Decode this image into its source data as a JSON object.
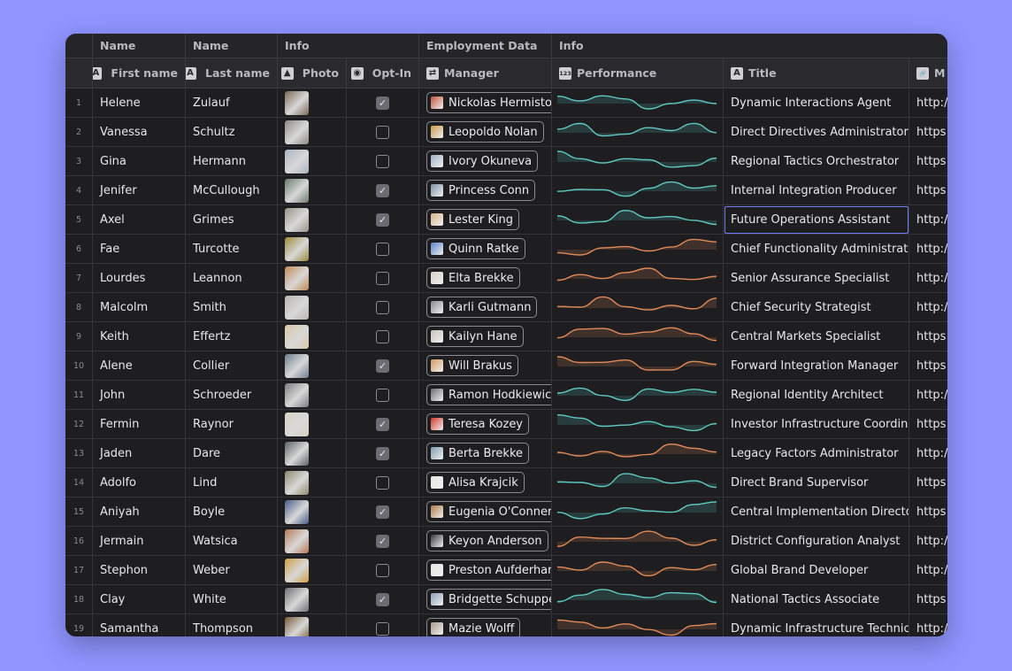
{
  "group_headers": [
    {
      "label": "",
      "col": 0
    },
    {
      "label": "Name",
      "col": 1
    },
    {
      "label": "Name",
      "col": 2
    },
    {
      "label": "Info",
      "col": 3
    },
    {
      "label": "Employment Data",
      "col": 5
    },
    {
      "label": "Info",
      "col": 6
    }
  ],
  "columns": [
    {
      "label": "",
      "icon": "",
      "icon_name": ""
    },
    {
      "label": "First name",
      "icon": "A",
      "icon_name": "text-icon"
    },
    {
      "label": "Last name",
      "icon": "A",
      "icon_name": "text-icon"
    },
    {
      "label": "Photo",
      "icon": "▲",
      "icon_name": "image-icon"
    },
    {
      "label": "Opt-In",
      "icon": "◉",
      "icon_name": "toggle-icon"
    },
    {
      "label": "Manager",
      "icon": "⇄",
      "icon_name": "relation-icon"
    },
    {
      "label": "Performance",
      "icon": "123",
      "icon_name": "number-icon"
    },
    {
      "label": "Title",
      "icon": "A",
      "icon_name": "text-icon"
    },
    {
      "label": "M",
      "icon": "🔗",
      "icon_name": "link-icon"
    }
  ],
  "colors": {
    "background": "#8f94ff",
    "window": "#1e1e20",
    "selection": "#6f7cff",
    "spark_teal": "#5fc9c0",
    "spark_orange": "#e08a5a"
  },
  "rows": [
    {
      "n": "1",
      "first": "Helene",
      "last": "Zulauf",
      "photo": "#7a6a55",
      "opt": true,
      "manager": "Nickolas Hermiston",
      "mgr_color": "#c0533a",
      "title": "Dynamic Interactions Agent",
      "url": "http://",
      "trend": "teal"
    },
    {
      "n": "2",
      "first": "Vanessa",
      "last": "Schultz",
      "photo": "#8c8a86",
      "opt": false,
      "manager": "Leopoldo Nolan",
      "mgr_color": "#c99a4a",
      "title": "Direct Directives Administrator",
      "url": "https:",
      "trend": "teal"
    },
    {
      "n": "3",
      "first": "Gina",
      "last": "Hermann",
      "photo": "#a9b4bf",
      "opt": false,
      "manager": "Ivory Okuneva",
      "mgr_color": "#9fb0c4",
      "title": "Regional Tactics Orchestrator",
      "url": "https:",
      "trend": "teal"
    },
    {
      "n": "4",
      "first": "Jenifer",
      "last": "McCullough",
      "photo": "#6a7a6e",
      "opt": true,
      "manager": "Princess Conn",
      "mgr_color": "#7d93a6",
      "title": "Internal Integration Producer",
      "url": "https:",
      "trend": "teal"
    },
    {
      "n": "5",
      "first": "Axel",
      "last": "Grimes",
      "photo": "#9a9288",
      "opt": true,
      "manager": "Lester King",
      "mgr_color": "#d6b48a",
      "title": "Future Operations Assistant",
      "url": "http://",
      "trend": "teal"
    },
    {
      "n": "6",
      "first": "Fae",
      "last": "Turcotte",
      "photo": "#9a8a3a",
      "opt": false,
      "manager": "Quinn Ratke",
      "mgr_color": "#5a84c9",
      "title": "Chief Functionality Administrator",
      "url": "http://",
      "trend": "orange"
    },
    {
      "n": "7",
      "first": "Lourdes",
      "last": "Leannon",
      "photo": "#c08a55",
      "opt": false,
      "manager": "Elta Brekke",
      "mgr_color": "#d8d2c8",
      "title": "Senior Assurance Specialist",
      "url": "http://",
      "trend": "orange"
    },
    {
      "n": "8",
      "first": "Malcolm",
      "last": "Smith",
      "photo": "#b8b6b2",
      "opt": false,
      "manager": "Karli Gutmann",
      "mgr_color": "#8a8a8e",
      "title": "Chief Security Strategist",
      "url": "http://",
      "trend": "orange"
    },
    {
      "n": "9",
      "first": "Keith",
      "last": "Effertz",
      "photo": "#d9c6a6",
      "opt": false,
      "manager": "Kailyn Hane",
      "mgr_color": "#c9c3ba",
      "title": "Central Markets Specialist",
      "url": "https:",
      "trend": "orange"
    },
    {
      "n": "10",
      "first": "Alene",
      "last": "Collier",
      "photo": "#6f7e8c",
      "opt": true,
      "manager": "Will Brakus",
      "mgr_color": "#d49a5e",
      "title": "Forward Integration Manager",
      "url": "https:",
      "trend": "orange"
    },
    {
      "n": "11",
      "first": "John",
      "last": "Schroeder",
      "photo": "#7c7c80",
      "opt": false,
      "manager": "Ramon Hodkiewicz",
      "mgr_color": "#6e6e72",
      "title": "Regional Identity Architect",
      "url": "http://",
      "trend": "teal"
    },
    {
      "n": "12",
      "first": "Fermin",
      "last": "Raynor",
      "photo": "#d8d2c4",
      "opt": true,
      "manager": "Teresa Kozey",
      "mgr_color": "#d33a2e",
      "title": "Investor Infrastructure Coordinato",
      "url": "https:",
      "trend": "teal"
    },
    {
      "n": "13",
      "first": "Jaden",
      "last": "Dare",
      "photo": "#5c6266",
      "opt": true,
      "manager": "Berta Brekke",
      "mgr_color": "#7e9cb0",
      "title": "Legacy Factors Administrator",
      "url": "http://",
      "trend": "orange"
    },
    {
      "n": "14",
      "first": "Adolfo",
      "last": "Lind",
      "photo": "#8c8a6e",
      "opt": false,
      "manager": "Alisa Krajcik",
      "mgr_color": "#e6e6e6",
      "title": "Direct Brand Supervisor",
      "url": "https:",
      "trend": "teal"
    },
    {
      "n": "15",
      "first": "Aniyah",
      "last": "Boyle",
      "photo": "#4a5a8a",
      "opt": true,
      "manager": "Eugenia O'Conner",
      "mgr_color": "#b07a48",
      "title": "Central Implementation Director",
      "url": "https:",
      "trend": "teal"
    },
    {
      "n": "16",
      "first": "Jermain",
      "last": "Watsica",
      "photo": "#b87a58",
      "opt": true,
      "manager": "Keyon Anderson",
      "mgr_color": "#3a3a3e",
      "title": "District Configuration Analyst",
      "url": "http://",
      "trend": "orange"
    },
    {
      "n": "17",
      "first": "Stephon",
      "last": "Weber",
      "photo": "#d0a048",
      "opt": false,
      "manager": "Preston Aufderhar",
      "mgr_color": "#e4e4e4",
      "title": "Global Brand Developer",
      "url": "http://",
      "trend": "orange"
    },
    {
      "n": "18",
      "first": "Clay",
      "last": "White",
      "photo": "#707074",
      "opt": true,
      "manager": "Bridgette Schuppe",
      "mgr_color": "#8aa0b8",
      "title": "National Tactics Associate",
      "url": "https:",
      "trend": "teal"
    },
    {
      "n": "19",
      "first": "Samantha",
      "last": "Thompson",
      "photo": "#7a5a3a",
      "opt": false,
      "manager": "Mazie Wolff",
      "mgr_color": "#a89a8a",
      "title": "Dynamic Infrastructure Technician",
      "url": "http:/",
      "trend": "orange"
    }
  ]
}
